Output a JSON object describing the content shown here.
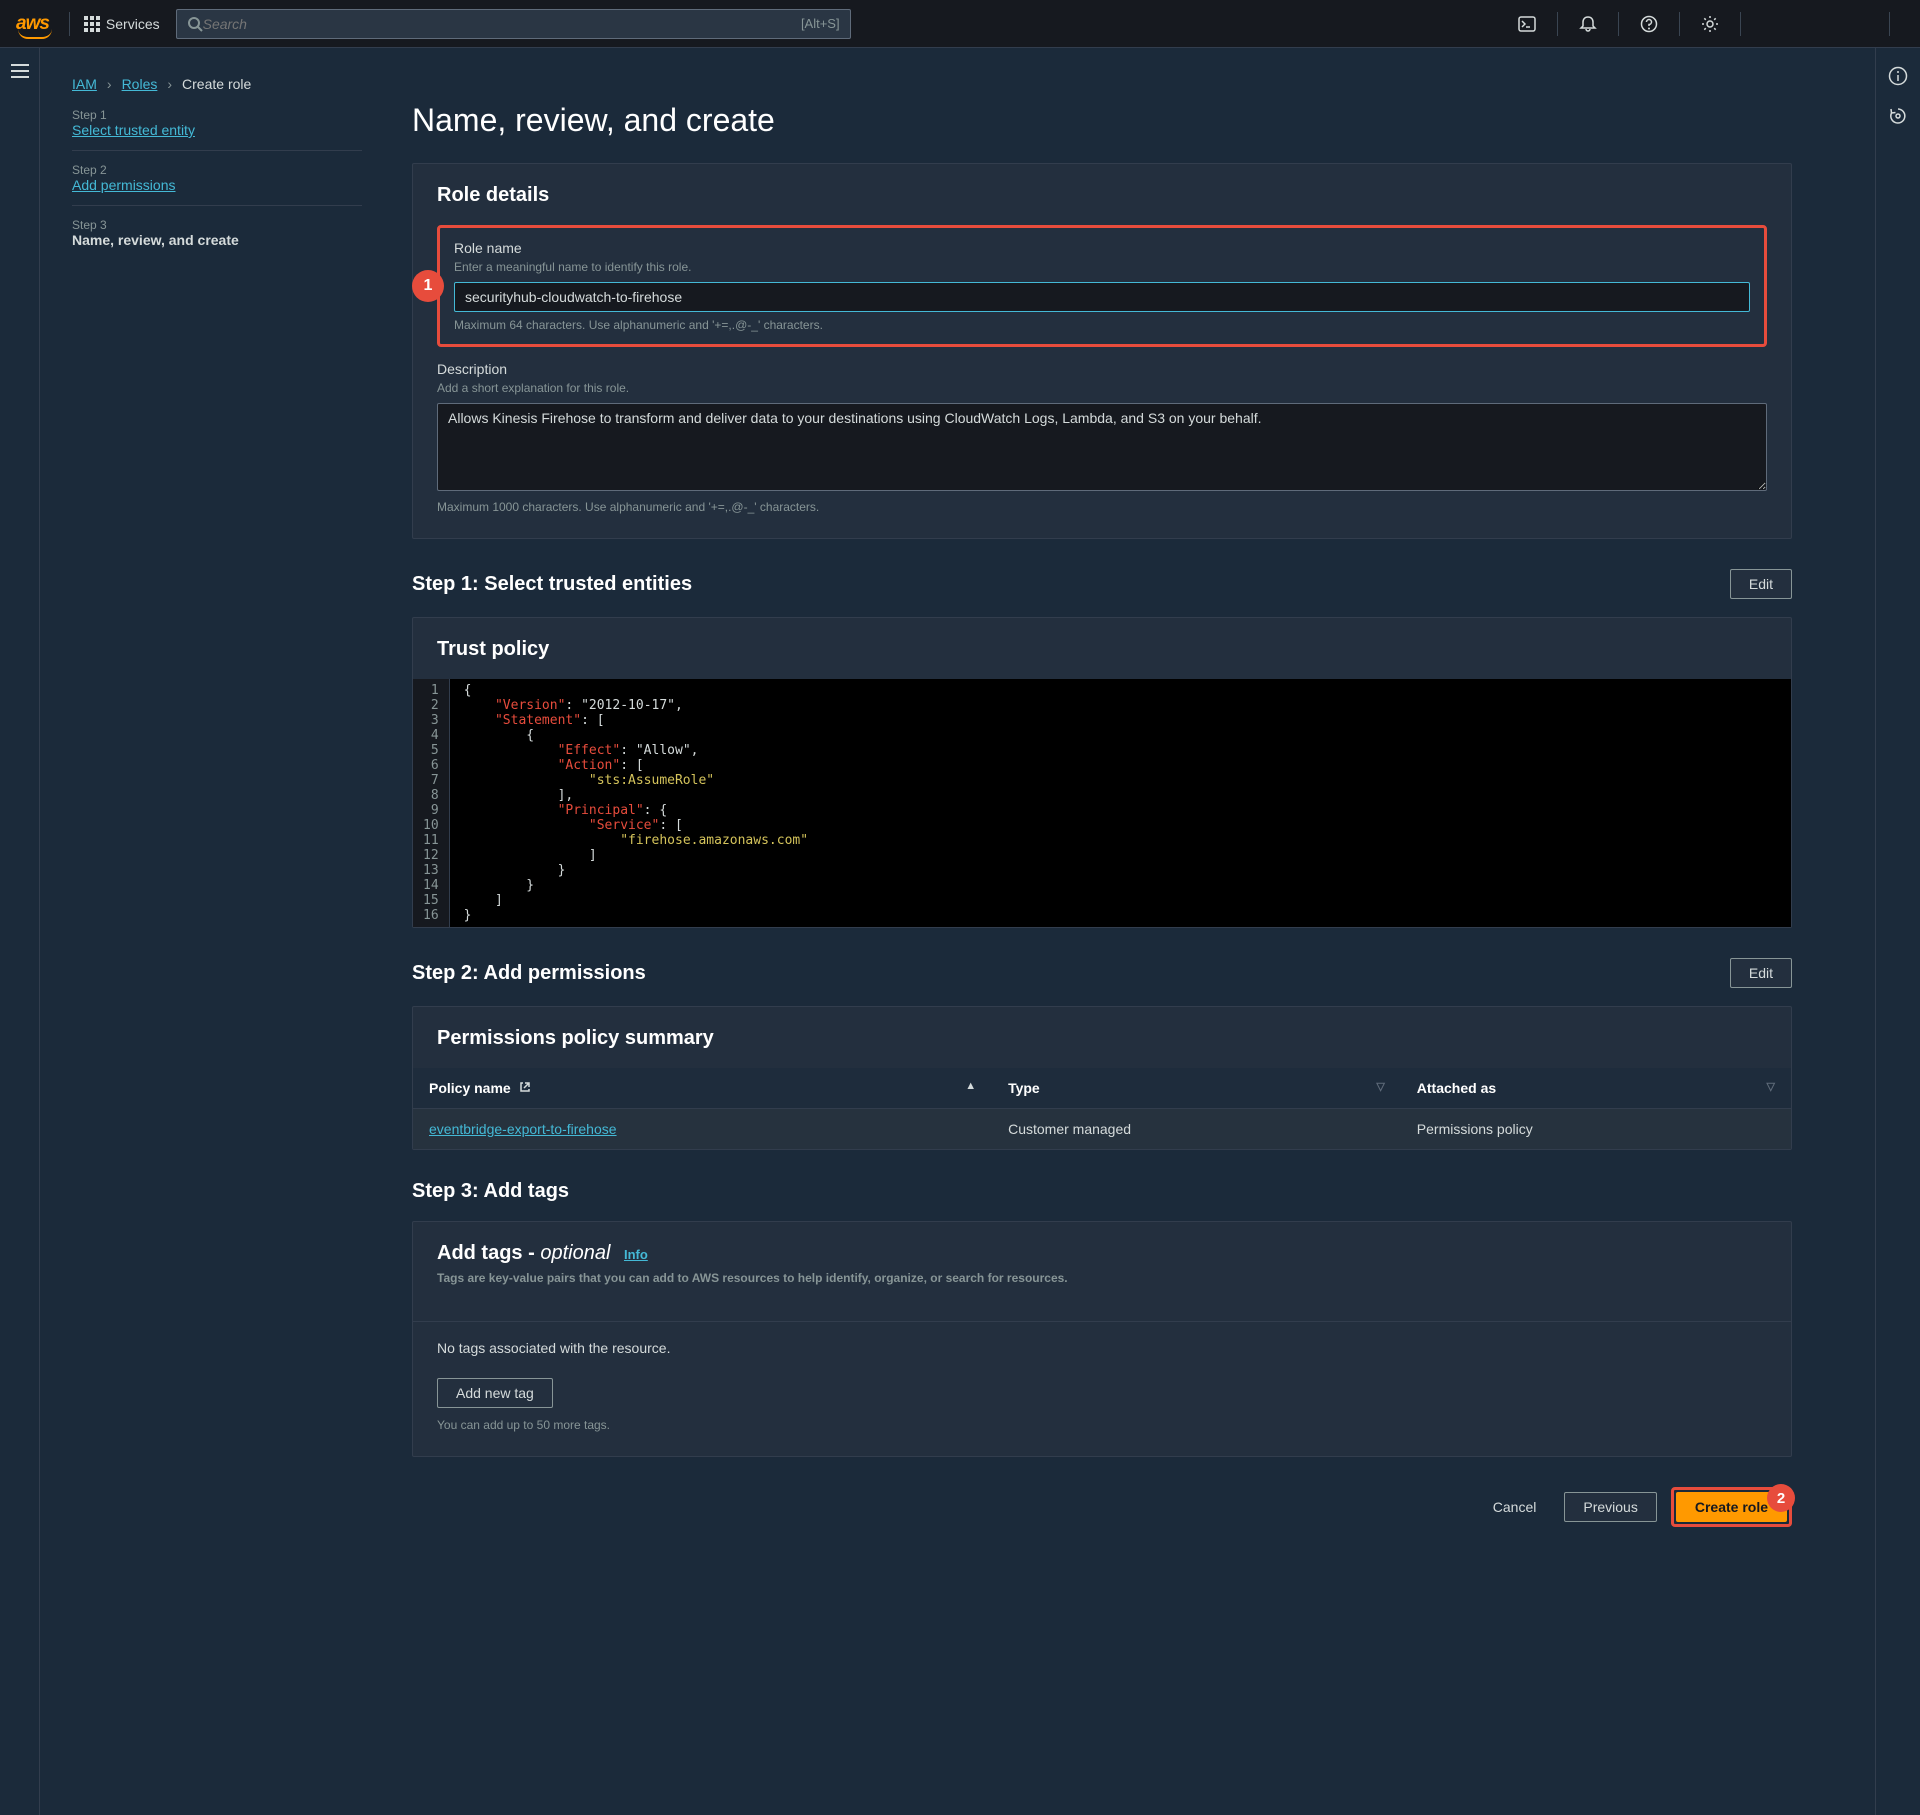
{
  "nav": {
    "logo_text": "aws",
    "services_label": "Services",
    "search_placeholder": "Search",
    "search_hint": "[Alt+S]"
  },
  "breadcrumb": {
    "root": "IAM",
    "l2": "Roles",
    "current": "Create role"
  },
  "wizard": {
    "steps": [
      {
        "num": "Step 1",
        "label": "Select trusted entity"
      },
      {
        "num": "Step 2",
        "label": "Add permissions"
      },
      {
        "num": "Step 3",
        "label": "Name, review, and create"
      }
    ]
  },
  "page": {
    "title": "Name, review, and create"
  },
  "role_details": {
    "heading": "Role details",
    "name_label": "Role name",
    "name_help": "Enter a meaningful name to identify this role.",
    "name_value": "securityhub-cloudwatch-to-firehose",
    "name_constraint": "Maximum 64 characters. Use alphanumeric and '+=,.@-_' characters.",
    "desc_label": "Description",
    "desc_help": "Add a short explanation for this role.",
    "desc_value": "Allows Kinesis Firehose to transform and deliver data to your destinations using CloudWatch Logs, Lambda, and S3 on your behalf.",
    "desc_constraint": "Maximum 1000 characters. Use alphanumeric and '+=,.@-_' characters."
  },
  "step1": {
    "heading": "Step 1: Select trusted entities",
    "edit": "Edit",
    "trust_heading": "Trust policy",
    "code": {
      "lines": [
        "{",
        "    \"Version\": \"2012-10-17\",",
        "    \"Statement\": [",
        "        {",
        "            \"Effect\": \"Allow\",",
        "            \"Action\": [",
        "                \"sts:AssumeRole\"",
        "            ],",
        "            \"Principal\": {",
        "                \"Service\": [",
        "                    \"firehose.amazonaws.com\"",
        "                ]",
        "            }",
        "        }",
        "    ]",
        "}"
      ]
    }
  },
  "step2": {
    "heading": "Step 2: Add permissions",
    "edit": "Edit",
    "summary_heading": "Permissions policy summary",
    "columns": {
      "c1": "Policy name",
      "c2": "Type",
      "c3": "Attached as"
    },
    "rows": [
      {
        "name": "eventbridge-export-to-firehose",
        "type": "Customer managed",
        "attached": "Permissions policy"
      }
    ]
  },
  "step3": {
    "heading": "Step 3: Add tags",
    "tags_heading": "Add tags - ",
    "optional": "optional",
    "info": "Info",
    "tags_desc": "Tags are key-value pairs that you can add to AWS resources to help identify, organize, or search for resources.",
    "no_tags": "No tags associated with the resource.",
    "add_tag": "Add new tag",
    "limit": "You can add up to 50 more tags."
  },
  "footer": {
    "cancel": "Cancel",
    "previous": "Previous",
    "create": "Create role"
  },
  "callouts": {
    "one": "1",
    "two": "2"
  }
}
